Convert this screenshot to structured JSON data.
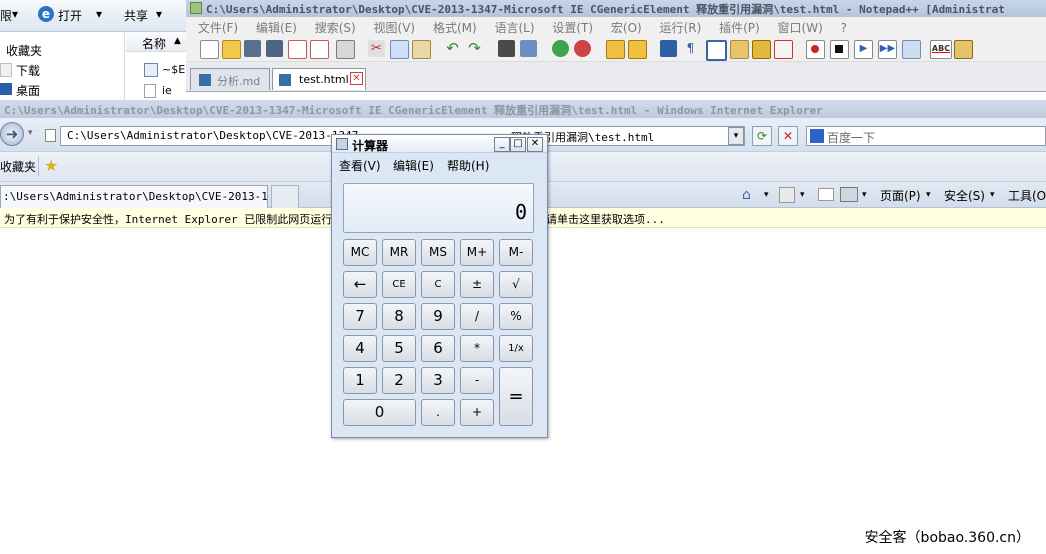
{
  "explorer": {
    "toolbar": {
      "left_fragment": "限",
      "open_label": "打开",
      "share_label": "共享"
    },
    "nav": {
      "favorites": "收藏夹",
      "downloads": "下载",
      "desktop": "桌面"
    },
    "files": {
      "column_name": "名称",
      "file1": "~$E",
      "file2": "ie"
    }
  },
  "notepad": {
    "title": "C:\\Users\\Administrator\\Desktop\\CVE-2013-1347-Microsoft IE CGenericElement 释放重引用漏洞\\test.html - Notepad++ [Administrat",
    "menus": [
      "文件(F)",
      "编辑(E)",
      "搜索(S)",
      "视图(V)",
      "格式(M)",
      "语言(L)",
      "设置(T)",
      "宏(O)",
      "运行(R)",
      "插件(P)",
      "窗口(W)",
      "?"
    ],
    "tabs": [
      {
        "label": "分析.md"
      },
      {
        "label": "test.html"
      }
    ],
    "colors": {
      "saved_tab_icon": "#3a6ea5",
      "close_icon": "#d23b3b"
    }
  },
  "ie": {
    "title": "C:\\Users\\Administrator\\Desktop\\CVE-2013-1347-Microsoft IE CGenericElement 释放重引用漏洞\\test.html - Windows Internet Explorer",
    "address_left": "C:\\Users\\Administrator\\Desktop\\CVE-2013-1347",
    "address_right": "释放重引用漏洞\\test.html",
    "search_placeholder": "百度一下",
    "favorites_label": "收藏夹",
    "tab_label": ":\\Users\\Administrator\\Desktop\\CVE-2013-1...",
    "commands": {
      "page": "页面(P)",
      "safety": "安全(S)",
      "tools": "工具(O)"
    },
    "infobar_left": "为了有利于保护安全性，Internet Explorer 已限制此网页运行可",
    "infobar_right": "请单击这里获取选项..."
  },
  "calculator": {
    "title": "计算器",
    "menus": [
      "查看(V)",
      "编辑(E)",
      "帮助(H)"
    ],
    "display": "0",
    "keys": {
      "mc": "MC",
      "mr": "MR",
      "ms": "MS",
      "mplus": "M+",
      "mminus": "M-",
      "backspace": "←",
      "ce": "CE",
      "c": "C",
      "plusminus": "±",
      "sqrt": "√",
      "k7": "7",
      "k8": "8",
      "k9": "9",
      "divide": "/",
      "percent": "%",
      "k4": "4",
      "k5": "5",
      "k6": "6",
      "multiply": "*",
      "reciprocal": "1/x",
      "k1": "1",
      "k2": "2",
      "k3": "3",
      "minus": "-",
      "equals": "=",
      "k0": "0",
      "dot": ".",
      "plus": "+"
    }
  },
  "watermark": "安全客（bobao.360.cn）"
}
